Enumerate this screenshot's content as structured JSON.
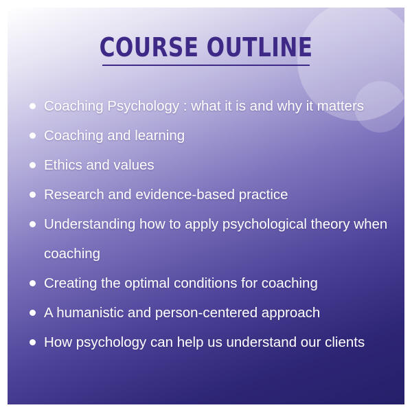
{
  "title": "COURSE OUTLINE",
  "items": [
    "Coaching Psychology : what it is and why it matters",
    "Coaching and learning",
    "Ethics and values",
    "Research and evidence-based practice",
    "Understanding how to apply psychological theory when coaching",
    "Creating the optimal conditions for coaching",
    "A humanistic and person-centered approach",
    "How psychology can help us understand our clients"
  ],
  "colors": {
    "title": "#3e2a86",
    "text": "#ffffff",
    "gradient_top": "#ffffff",
    "gradient_bottom": "#25206a"
  }
}
